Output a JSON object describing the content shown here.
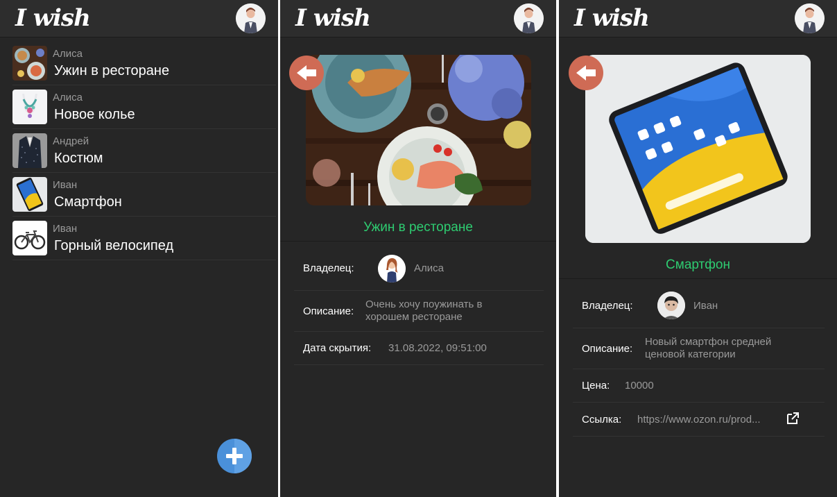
{
  "app": {
    "title": "I wish"
  },
  "list": {
    "items": [
      {
        "owner": "Алиса",
        "title": "Ужин в ресторане",
        "thumb": "food-thumbnail"
      },
      {
        "owner": "Алиса",
        "title": "Новое колье",
        "thumb": "necklace-thumbnail"
      },
      {
        "owner": "Андрей",
        "title": "Костюм",
        "thumb": "suit-thumbnail"
      },
      {
        "owner": "Иван",
        "title": "Смартфон",
        "thumb": "smartphone-thumbnail"
      },
      {
        "owner": "Иван",
        "title": "Горный велосипед",
        "thumb": "bicycle-thumbnail"
      }
    ],
    "add_icon": "plus-icon"
  },
  "detail_dinner": {
    "title": "Ужин в ресторане",
    "owner_label": "Владелец:",
    "owner_name": "Алиса",
    "description_label": "Описание:",
    "description_line1": "Очень хочу поужинать в",
    "description_line2": "хорошем ресторане",
    "hide_date_label": "Дата скрытия:",
    "hide_date": "31.08.2022, 09:51:00"
  },
  "detail_phone": {
    "title": "Смартфон",
    "owner_label": "Владелец:",
    "owner_name": "Иван",
    "description_label": "Описание:",
    "description_line1": "Новый смартфон средней",
    "description_line2": "ценовой категории",
    "price_label": "Цена:",
    "price": "10000",
    "link_label": "Ссылка:",
    "link": "https://www.ozon.ru/prod..."
  },
  "colors": {
    "background": "#262626",
    "header": "#2d2d2d",
    "accent_green": "#2ecc71",
    "back_button": "#cf6b55",
    "fab": "#4a90d9"
  }
}
